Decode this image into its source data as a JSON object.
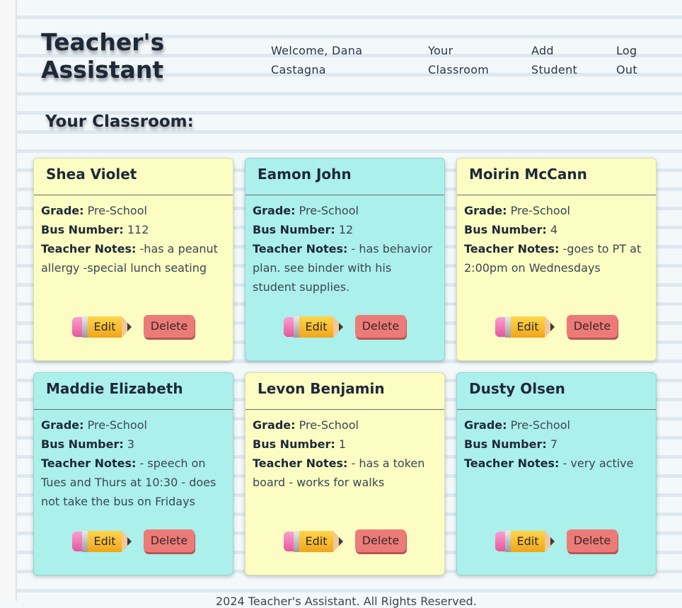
{
  "app": {
    "title": "Teacher's Assistant"
  },
  "nav": {
    "welcome": "Welcome, Dana Castagna",
    "classroom": "Your Classroom",
    "add_student": "Add Student",
    "logout": "Log Out"
  },
  "section_title": "Your Classroom:",
  "labels": {
    "grade": "Grade:",
    "bus": "Bus Number:",
    "notes": "Teacher Notes:",
    "edit": "Edit",
    "delete": "Delete"
  },
  "colors": {
    "yellow_card": "#fbfdc3",
    "teal_card": "#abf0ea",
    "delete": "#ec7b78"
  },
  "students": [
    {
      "name": "Shea Violet",
      "grade": "Pre-School",
      "bus": "112",
      "notes": "-has a peanut allergy -special lunch seating",
      "color": "yellow"
    },
    {
      "name": "Eamon John",
      "grade": "Pre-School",
      "bus": "12",
      "notes": "- has behavior plan. see binder with his student supplies.",
      "color": "teal"
    },
    {
      "name": "Moirin McCann",
      "grade": "Pre-School",
      "bus": "4",
      "notes": "-goes to PT at 2:00pm on Wednesdays",
      "color": "yellow"
    },
    {
      "name": "Maddie Elizabeth",
      "grade": "Pre-School",
      "bus": "3",
      "notes": "- speech on Tues and Thurs at 10:30 - does not take the bus on Fridays",
      "color": "teal"
    },
    {
      "name": "Levon Benjamin",
      "grade": "Pre-School",
      "bus": "1",
      "notes": "- has a token board - works for walks",
      "color": "yellow"
    },
    {
      "name": "Dusty Olsen",
      "grade": "Pre-School",
      "bus": "7",
      "notes": "- very active",
      "color": "teal"
    }
  ],
  "footer": "2024 Teacher's Assistant. All Rights Reserved."
}
